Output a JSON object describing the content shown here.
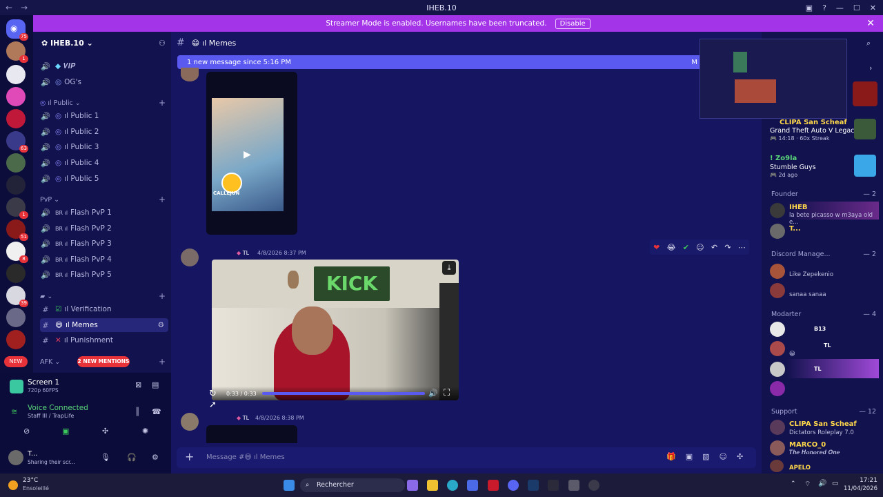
{
  "window": {
    "title": "IHEB.10",
    "back": "←",
    "forward": "→"
  },
  "banner": {
    "text": "Streamer Mode is enabled. Usernames have been truncated.",
    "button": "Disable"
  },
  "server_badges": {
    "home": "75",
    "s2": "1",
    "s7": "63",
    "s10": "1",
    "s11": "51",
    "s12": "8",
    "s14": "39",
    "new": "NEW"
  },
  "sidebar": {
    "server_name": "IHEB.10",
    "channels_top": [
      {
        "label": "𝑽𝑰𝑷"
      },
      {
        "label": "OG's"
      }
    ],
    "public_category": "ıl Public",
    "public_channels": [
      "ıl Public 1",
      "ıl Public 2",
      "ıl Public 3",
      "ıl Public 4",
      "ıl Public 5"
    ],
    "pvp_category": "PvP",
    "pvp_channels": [
      "Flash PvP 1",
      "Flash PvP 2",
      "Flash PvP 3",
      "Flash PvP 4",
      "Flash PvP 5"
    ],
    "pvp_prefix": "BR ıl",
    "text_channels": [
      "ıl Verification",
      "ıl Memes",
      "ıl Punishment"
    ],
    "afk_category": "AFK",
    "mentions_pill": "2 NEW MENTIONS"
  },
  "voice": {
    "screen_title": "Screen 1",
    "screen_sub": "720p 60FPS",
    "connected": "Voice Connected",
    "channel": "Staff III / TrapLife",
    "user_name": "T...",
    "user_status": "Sharing their scr..."
  },
  "main": {
    "channel_name": "ıl Memes",
    "new_message": "1 new message since 5:16 PM",
    "mark": "M",
    "message2": {
      "tag": "TL",
      "time": "4/8/2026 8:37 PM"
    },
    "video": {
      "time": "0:33 / 0:33",
      "progress": 1.0,
      "sign": "KICK"
    },
    "message3": {
      "tag": "TL",
      "time": "4/8/2026 8:38 PM"
    },
    "composer_placeholder": "Message #😄 ıl Memes",
    "thumb_caption": "CALLEJUN"
  },
  "members": {
    "activity1": {
      "name": "CLIPA San Scheaf",
      "game": "Grand Theft Auto V Legacy",
      "meta": "14:18",
      "streak": "60x Streak"
    },
    "activity2": {
      "name": "! Zo9la",
      "game": "Stumble Guys",
      "meta": "2d ago"
    },
    "groups": [
      {
        "title": "Founder",
        "count": "— 2",
        "members": [
          {
            "name": "IHEB",
            "sub": "la bete picasso w m3aya old e...",
            "color": "#ffd84a"
          },
          {
            "name": "T...",
            "sub": "",
            "color": "#ffd84a"
          }
        ]
      },
      {
        "title": "Discord Manage...",
        "count": "— 2",
        "members": [
          {
            "name": "",
            "sub": "Like Zepekenio",
            "color": "#c86ad8"
          },
          {
            "name": "",
            "sub": "sanaa sanaa",
            "color": "#c86ad8"
          }
        ]
      },
      {
        "title": "Modarter",
        "count": "— 4",
        "members": [
          {
            "name": "B13",
            "sub": "",
            "color": "#6a6af0"
          },
          {
            "name": "TL",
            "sub": "😀",
            "color": "#6a6af0"
          },
          {
            "name": "TL",
            "sub": "",
            "color": "#6a6af0"
          },
          {
            "name": "",
            "sub": "",
            "color": "#6a6af0"
          }
        ]
      },
      {
        "title": "Support",
        "count": "— 12",
        "members": [
          {
            "name": "CLIPA San Scheaf",
            "sub": "Dictators Roleplay 7.0",
            "color": "#ffd84a"
          },
          {
            "name": "MARCO_0",
            "sub": "𝑻𝒉𝒆 𝑯𝒐𝒏𝒐𝒓𝒆𝒅 𝑶𝒏𝒆",
            "color": "#ffd84a"
          },
          {
            "name": "APELO",
            "sub": "",
            "color": "#ffd84a"
          }
        ]
      }
    ]
  },
  "taskbar": {
    "temp": "23°C",
    "weather": "Ensoleillé",
    "search": "Rechercher",
    "time": "17:21",
    "date": "11/04/2026"
  },
  "colors": {
    "banner": "#a434e8",
    "accent": "#5a5af0",
    "bg": "#151562"
  }
}
